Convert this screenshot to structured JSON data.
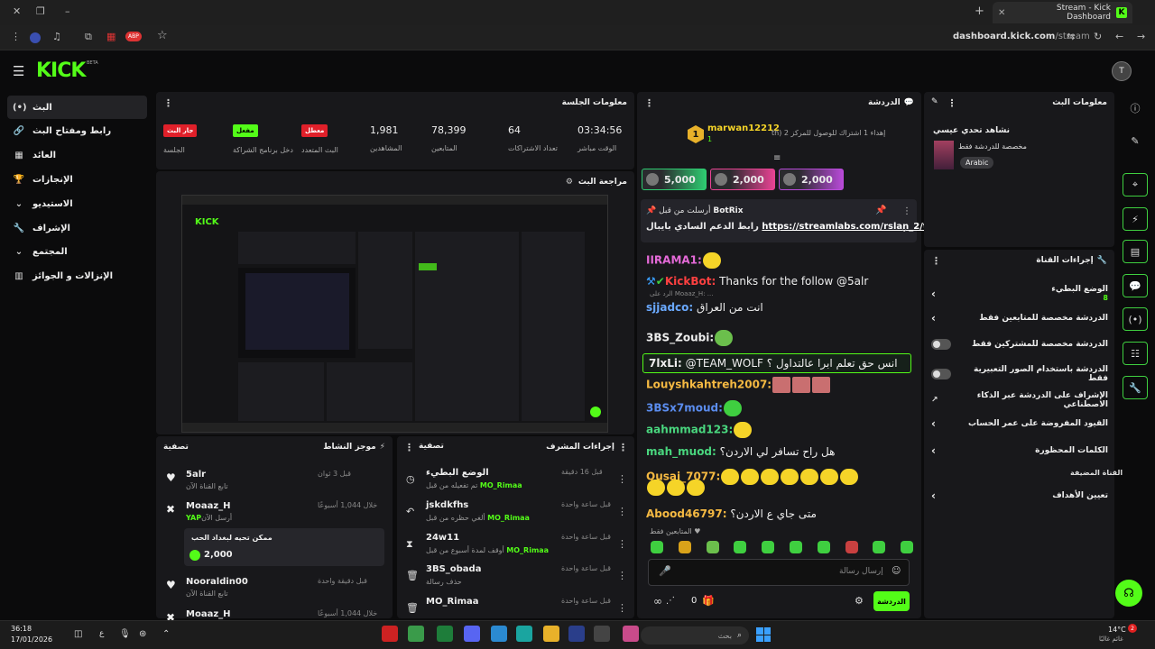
{
  "browser": {
    "tab_title": "Stream - Kick Dashboard",
    "url_host": "dashboard.kick.com",
    "url_path": "/stream"
  },
  "app": {
    "logo": "KICK",
    "beta": "BETA",
    "avatar": "T"
  },
  "sidebar": {
    "items": [
      {
        "label": "البث",
        "icon": "broadcast-icon",
        "glyph": "(•)"
      },
      {
        "label": "رابط ومفتاح البث",
        "icon": "link-icon",
        "glyph": "🔗"
      },
      {
        "label": "العائد",
        "icon": "revenue-icon",
        "glyph": "▦"
      },
      {
        "label": "الإنجازات",
        "icon": "trophy-icon",
        "glyph": "🏆"
      },
      {
        "label": "الاستيديو",
        "icon": "studio-icon",
        "glyph": "⌄"
      },
      {
        "label": "الإشراف",
        "icon": "wrench-icon",
        "glyph": "🔧"
      },
      {
        "label": "المجتمع",
        "icon": "community-icon",
        "glyph": "⌄"
      },
      {
        "label": "الإنزالات و الجوائز",
        "icon": "drops-icon",
        "glyph": "▥"
      }
    ]
  },
  "session": {
    "title": "معلومات الجلسة",
    "stats": [
      {
        "value": "03:34:56",
        "label": "الوقت مباشر"
      },
      {
        "value": "64",
        "label": "تعداد الاشتراكات"
      },
      {
        "value": "78,399",
        "label": "المتابعين"
      },
      {
        "value": "1,981",
        "label": "المشاهدين"
      }
    ],
    "badges": [
      {
        "text": "معطل",
        "label": "البث المتعدد",
        "color": "#e0202a"
      },
      {
        "text": "مفعل",
        "label": "دخل برنامج الشراكة",
        "color": "#53fc18"
      },
      {
        "text": "جار البث",
        "label": "الجلسة",
        "color": "#e0202a"
      }
    ]
  },
  "preview": {
    "title": "مراجعة البث"
  },
  "chat": {
    "title": "الدردشة",
    "top_user": "marwan12212",
    "top_rank": "1",
    "goal_text": "إهداء 1 اشتراك للوصول للمركز 2 (th",
    "gifts": [
      "5,000",
      "2,000",
      "2,000"
    ],
    "pinned_by": "أرسلت من قبل",
    "pinned_user": "BotRix",
    "pinned_msg_prefix": "رابط الدعم السادي بايبال",
    "pinned_link": "https://streamlabs.com/rslan_2/tip",
    "messages": [
      {
        "user": "IIRAMA1:",
        "color": "#e56ad8",
        "text": ""
      },
      {
        "user": "KickBot:",
        "color": "#ff4040",
        "text": " Thanks for the follow @5alr"
      },
      {
        "user": "sjjadco:",
        "color": "#6aa9ff",
        "text": " انت من العراق",
        "reply": "الرد على Moaaz_H: ..."
      },
      {
        "user": "3BS_Zoubi:",
        "color": "#eee",
        "text": ""
      },
      {
        "user": "7lxLi:",
        "color": "#eee",
        "text": " @TEAM_WOLF انس حق تعلم ابرا عالتداول ؟"
      },
      {
        "user": "Louyshkahtreh2007:",
        "color": "#f5b942",
        "text": ""
      },
      {
        "user": "3BSx7moud:",
        "color": "#5b8def",
        "text": ""
      },
      {
        "user": "aahmmad123:",
        "color": "#49d67e",
        "text": ""
      },
      {
        "user": "mah_muod:",
        "color": "#49d67e",
        "text": " هل راح تسافر لي الاردن؟"
      },
      {
        "user": "Qusai_7077:",
        "color": "#f5b942",
        "text": ""
      },
      {
        "user": "Abood46797:",
        "color": "#f5b942",
        "text": " متى جاي ع الاردن؟"
      }
    ],
    "followers_only": "المتابعين فقط",
    "input_placeholder": "إرسال رسالة",
    "send_label": "الدردشة",
    "count": "0"
  },
  "stream_info": {
    "title": "معلومات البث",
    "stream_title": "نشاهد تحدي عيسي",
    "category": "مخصصة للدردشة فقط",
    "language": "Arabic"
  },
  "channel": {
    "title": "إجراءات القناة",
    "rows": [
      {
        "label": "الوضع البطيء",
        "sub": "8",
        "control": "chevron"
      },
      {
        "label": "الدردشة مخصصة للمتابعين فقط",
        "control": "chevron"
      },
      {
        "label": "الدردشة مخصصة للمشتركين فقط",
        "control": "toggle"
      },
      {
        "label": "الدردشة باستخدام الصور التعبيرية فقط",
        "control": "toggle"
      },
      {
        "label": "الإشراف على الدردشة عبر الذكاء الاصطناعي",
        "control": "external"
      },
      {
        "label": "القيود المفروضة على عمر الحساب",
        "control": "chevron"
      },
      {
        "label": "الكلمات المحظورة",
        "control": "chevron"
      }
    ],
    "section": "القناة المضيفة",
    "targets": "تعيين الأهداف"
  },
  "activity": {
    "title": "موجز النشاط",
    "filter": "تصفية",
    "items": [
      {
        "name": "5alr",
        "sub": "تابع القناة الآن",
        "time": "قبل 3 ثوان",
        "icon": "heart-icon"
      },
      {
        "name": "Moaaz_H",
        "sub": "أرسل الآن",
        "extra": "YAP",
        "time": "خلال 1,044 أسبوعًا",
        "icon": "kick-icon"
      },
      {
        "name": "Nooraldin00",
        "sub": "تابع القناة الآن",
        "time": "قبل دقيقة واحدة",
        "icon": "heart-icon"
      },
      {
        "name": "Moaaz_H",
        "sub": "",
        "time": "خلال 1,044 أسبوعًا",
        "icon": "kick-icon"
      }
    ],
    "gift_box": {
      "title": "ممكن تحيه لبغداد الحب",
      "amount": "2,000"
    }
  },
  "modactions": {
    "title": "إجراءات المشرف",
    "filter": "تصفية",
    "items": [
      {
        "name": "الوضع البطيء",
        "sub": "تم تفعيله من قبل",
        "by": "MO_Rimaa",
        "time": "قبل 16 دقيقة",
        "icon": "clock-icon"
      },
      {
        "name": "jskdkfhs",
        "sub": "ألغي حظره من قبل",
        "by": "MO_Rimaa",
        "time": "قبل ساعة واحدة",
        "icon": "undo-icon"
      },
      {
        "name": "24w11",
        "sub": "أوقف لمدة أسبوع من قبل",
        "by": "MO_Rimaa",
        "time": "قبل ساعة واحدة",
        "icon": "hourglass-icon"
      },
      {
        "name": "3BS_obada",
        "sub": "حذف رسالة",
        "by": "",
        "time": "قبل ساعة واحدة",
        "icon": "trash-icon"
      },
      {
        "name": "MO_Rimaa",
        "sub": "",
        "by": "",
        "time": "قبل ساعة واحدة",
        "icon": "trash-icon"
      }
    ]
  },
  "taskbar": {
    "time": "36:18",
    "date": "17/01/2026",
    "search_placeholder": "بحث",
    "weather_temp": "14°C",
    "weather_text": "غائم غالبًا",
    "lang": "ع"
  }
}
